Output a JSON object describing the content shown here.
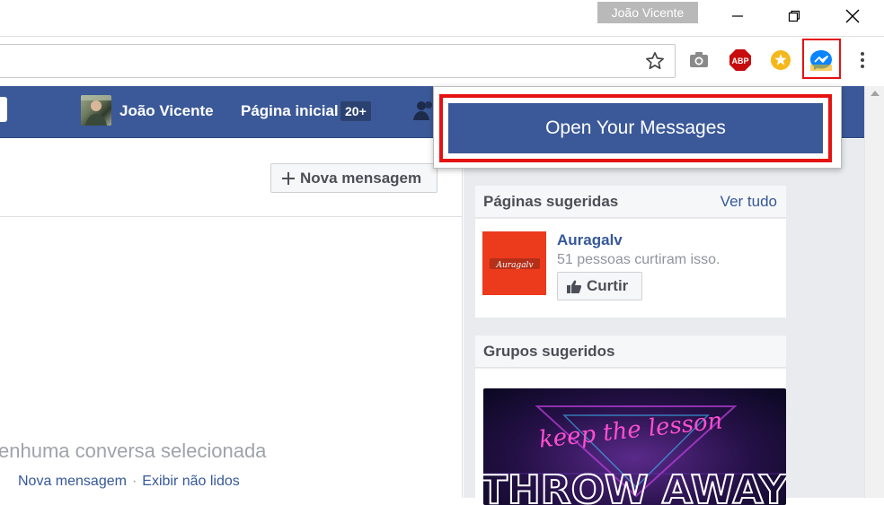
{
  "browser": {
    "profile_name": "João Vicente",
    "icons": [
      "minimize-icon",
      "restore-icon",
      "close-icon",
      "star-icon",
      "camera-icon",
      "abp-icon",
      "honey-icon",
      "messenger-icon",
      "menu-icon"
    ],
    "abp_label": "ABP"
  },
  "extension_popup": {
    "button_label": "Open Your Messages",
    "highlight_color": "#e51212"
  },
  "fb_header": {
    "user_name": "João Vicente",
    "home_label": "Página inicial",
    "home_badge": "20+",
    "brand_color": "#3b5998"
  },
  "main": {
    "new_message_button": "Nova mensagem",
    "empty_text": "enhuma conversa selecionada",
    "links": [
      "Nova mensagem",
      "Exibir não lidos"
    ],
    "link_separator": "·"
  },
  "sidebar": {
    "suggested_pages": {
      "title": "Páginas sugeridas",
      "see_all": "Ver tudo",
      "page_name": "Auragalv",
      "page_likes": "51 pessoas curtiram isso.",
      "like_button": "Curtir",
      "logo_text": "Auragalv"
    },
    "suggested_groups": {
      "title": "Grupos sugeridos",
      "image_text_line1": "keep the lesson",
      "image_text_line2": "THROW AWAY"
    }
  }
}
